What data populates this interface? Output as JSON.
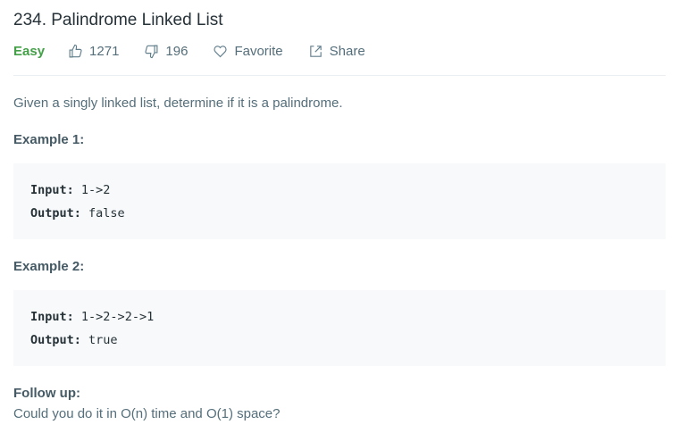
{
  "problem": {
    "title": "234. Palindrome Linked List",
    "difficulty": "Easy",
    "likes": "1271",
    "dislikes": "196",
    "favorite_label": "Favorite",
    "share_label": "Share",
    "description": "Given a singly linked list, determine if it is a palindrome."
  },
  "examples": [
    {
      "title": "Example 1:",
      "input_label": "Input:",
      "input": "1->2",
      "output_label": "Output:",
      "output": "false"
    },
    {
      "title": "Example 2:",
      "input_label": "Input:",
      "input": "1->2->2->1",
      "output_label": "Output:",
      "output": "true"
    }
  ],
  "follow_up": {
    "title": "Follow up:",
    "text": "Could you do it in O(n) time and O(1) space?"
  },
  "colors": {
    "difficulty_easy": "#43a047",
    "code_background": "#f7f9fa"
  },
  "icons": {
    "like": "thumbs-up-icon",
    "dislike": "thumbs-down-icon",
    "favorite": "heart-icon",
    "share": "share-icon"
  }
}
